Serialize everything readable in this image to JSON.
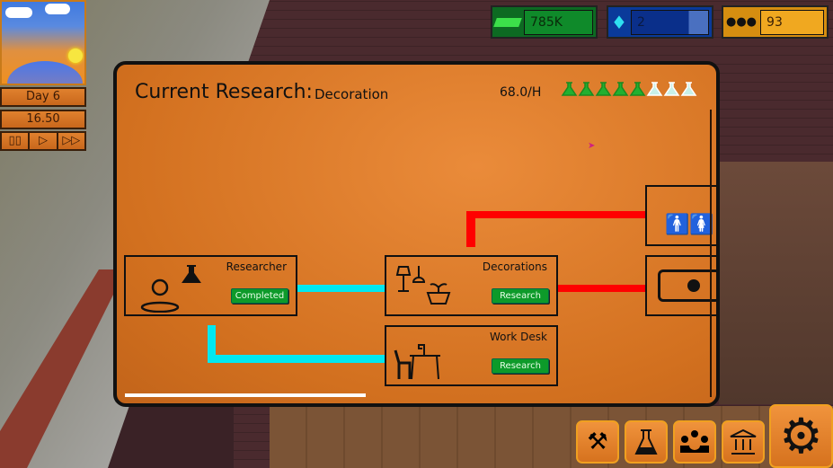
{
  "hud": {
    "money": "785K",
    "gems": "2",
    "people": "93",
    "day": "Day 6",
    "time": "16.50",
    "controls": [
      "pause",
      "play",
      "fast-forward"
    ],
    "control_glyphs": [
      "▯▯",
      "▷",
      "▷▷"
    ]
  },
  "research": {
    "title": "Current Research:",
    "current": "Decoration",
    "rate": "68.0/H",
    "flasks_total": 8,
    "flasks_filled_fraction": 0.64,
    "nodes": [
      {
        "name": "Researcher",
        "button": "Completed",
        "icon": "researcher-icon"
      },
      {
        "name": "Decorations",
        "button": "Research",
        "icon": "decorations-icon"
      },
      {
        "name": "Work Desk",
        "button": "Research",
        "icon": "work-desk-icon"
      }
    ],
    "colors": {
      "unlocked_link": "#00e8f0",
      "locked_link": "#ff0000",
      "button": "#0d9a2a"
    }
  },
  "toolbar": [
    "build-icon",
    "research-icon",
    "staff-icon",
    "bank-icon",
    "settings-icon"
  ]
}
